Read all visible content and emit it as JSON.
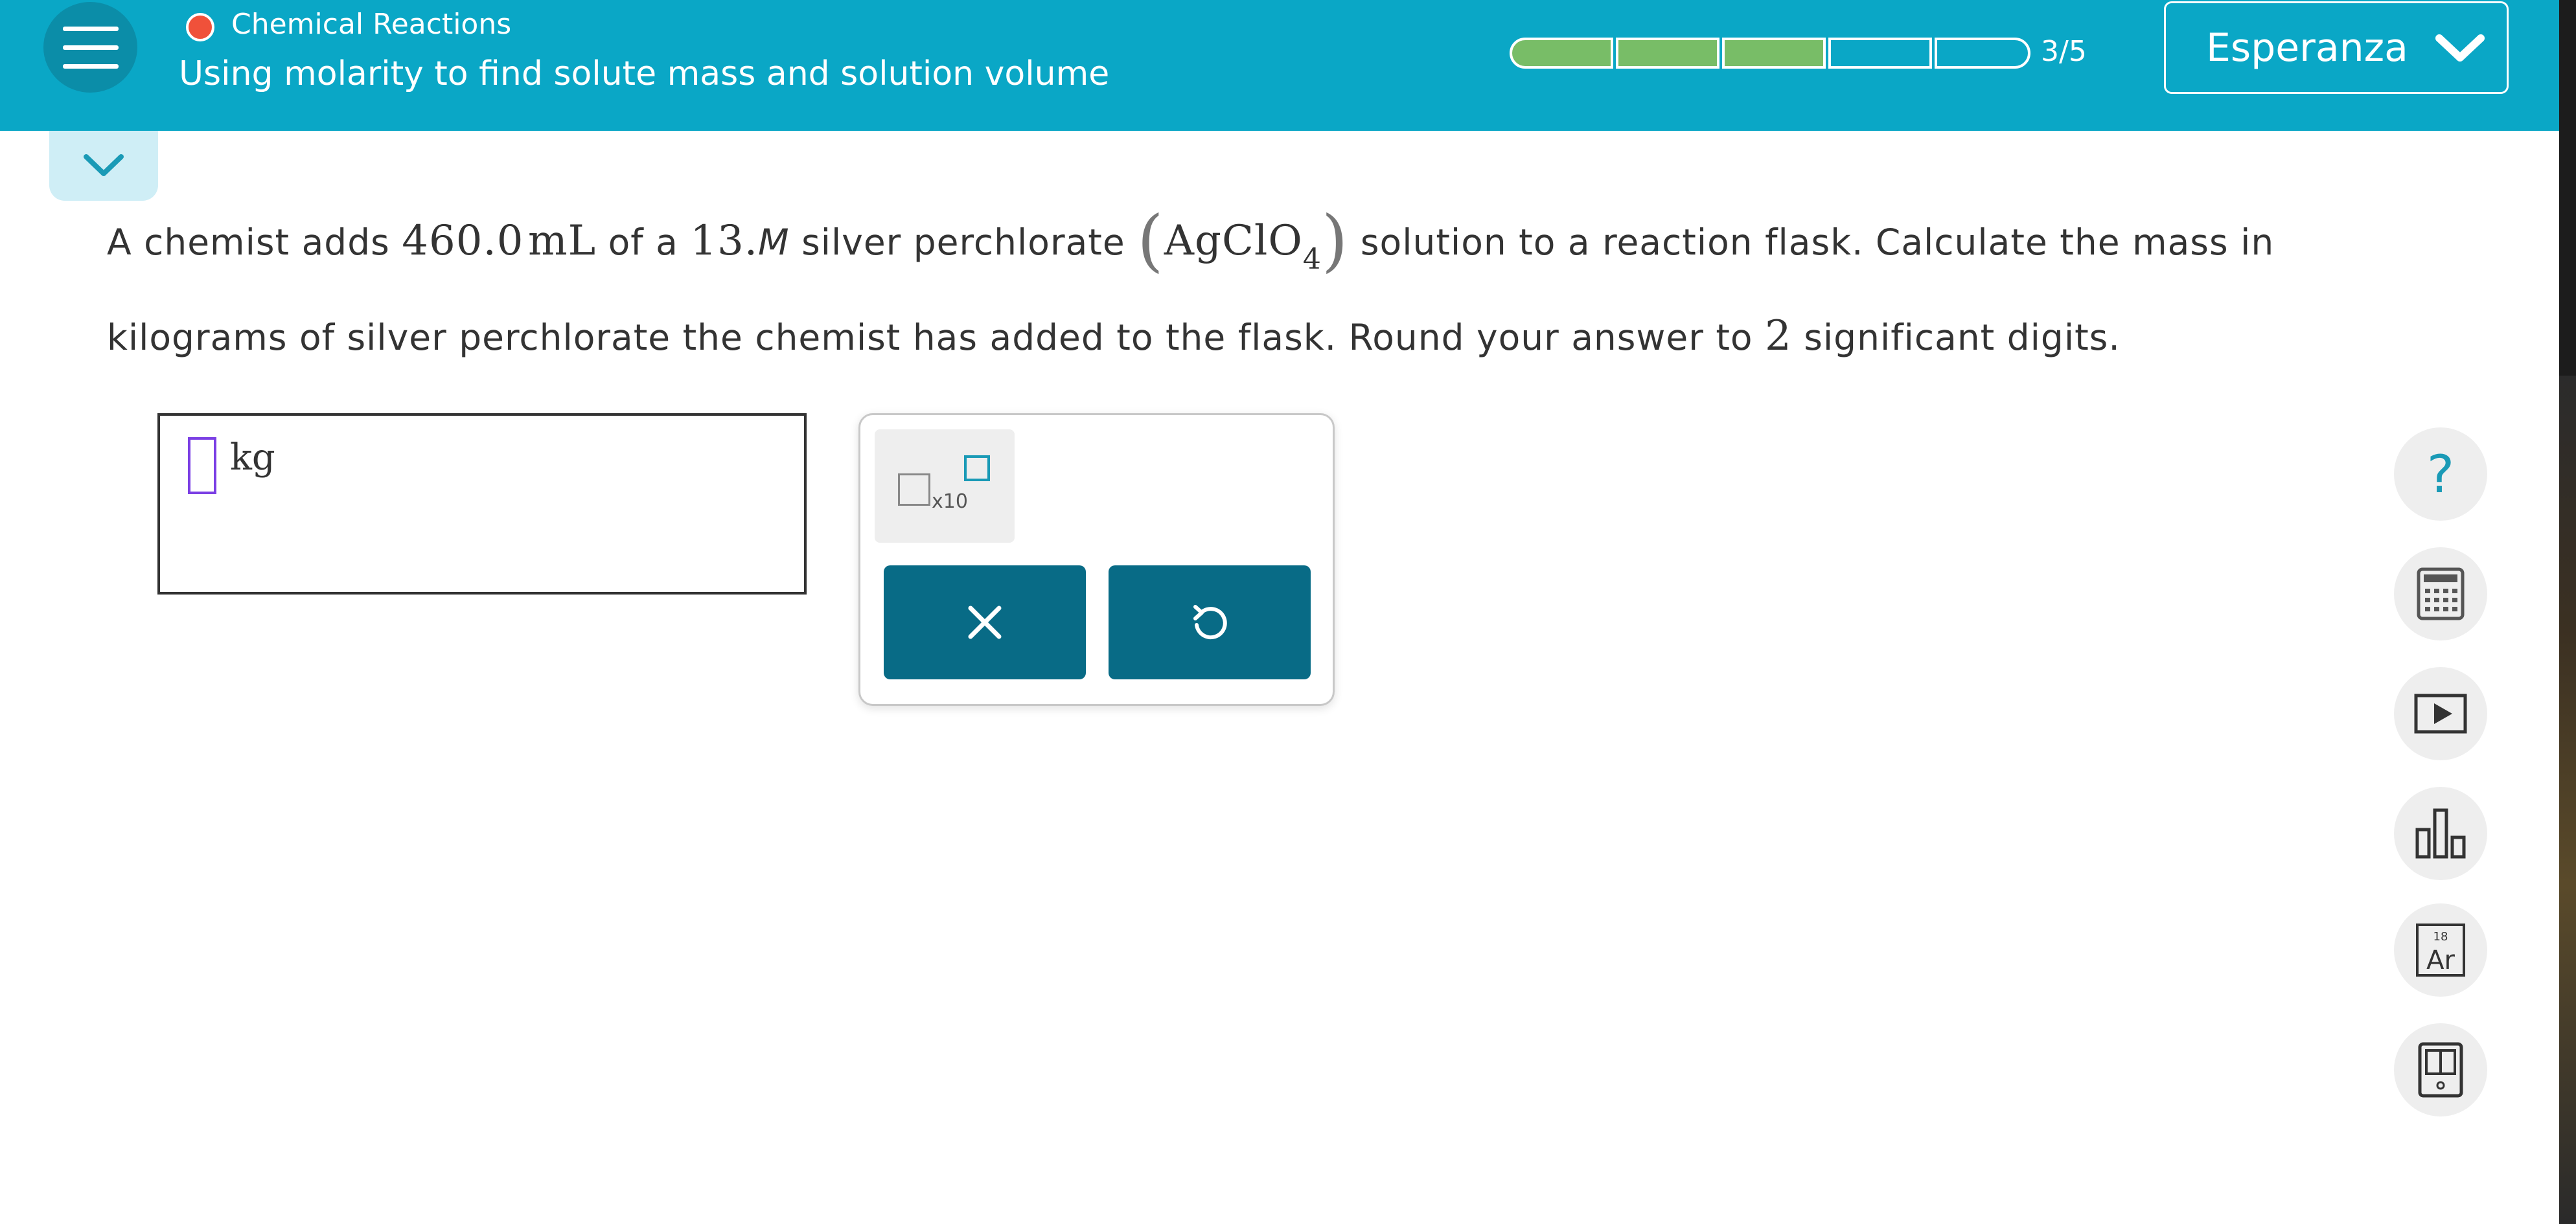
{
  "header": {
    "topic": "Chemical Reactions",
    "lesson_title": "Using molarity to find solute mass and solution volume",
    "progress_text": "3/5",
    "progress": {
      "segments": 5,
      "completed": 3
    },
    "user_name": "Esperanza",
    "accent_color": "#0aa7c6",
    "topic_dot_color": "#f0513a"
  },
  "question": {
    "t1": "A chemist adds ",
    "volume": "460.0",
    "vol_unit": "mL",
    "t2": " of a ",
    "conc": "13.",
    "conc_unit": "M",
    "t3": " silver perchlorate ",
    "formula_main": "AgClO",
    "formula_sub": "4",
    "t4": " solution to a reaction flask. Calculate the mass in",
    "t5": "kilograms of silver perchlorate the chemist has added to the flask. Round your answer to ",
    "sig_digits": "2",
    "t6": " significant digits."
  },
  "answer": {
    "unit": "kg"
  },
  "keypad": {
    "sci_label": "x10",
    "clear_icon": "close-icon",
    "undo_icon": "undo-icon"
  },
  "tools": {
    "help_glyph": "?",
    "icons": [
      "help-icon",
      "calculator-icon",
      "video-icon",
      "data-chart-icon",
      "periodic-table-icon",
      "textbook-icon"
    ],
    "periodic_number": "18",
    "periodic_symbol": "Ar"
  }
}
